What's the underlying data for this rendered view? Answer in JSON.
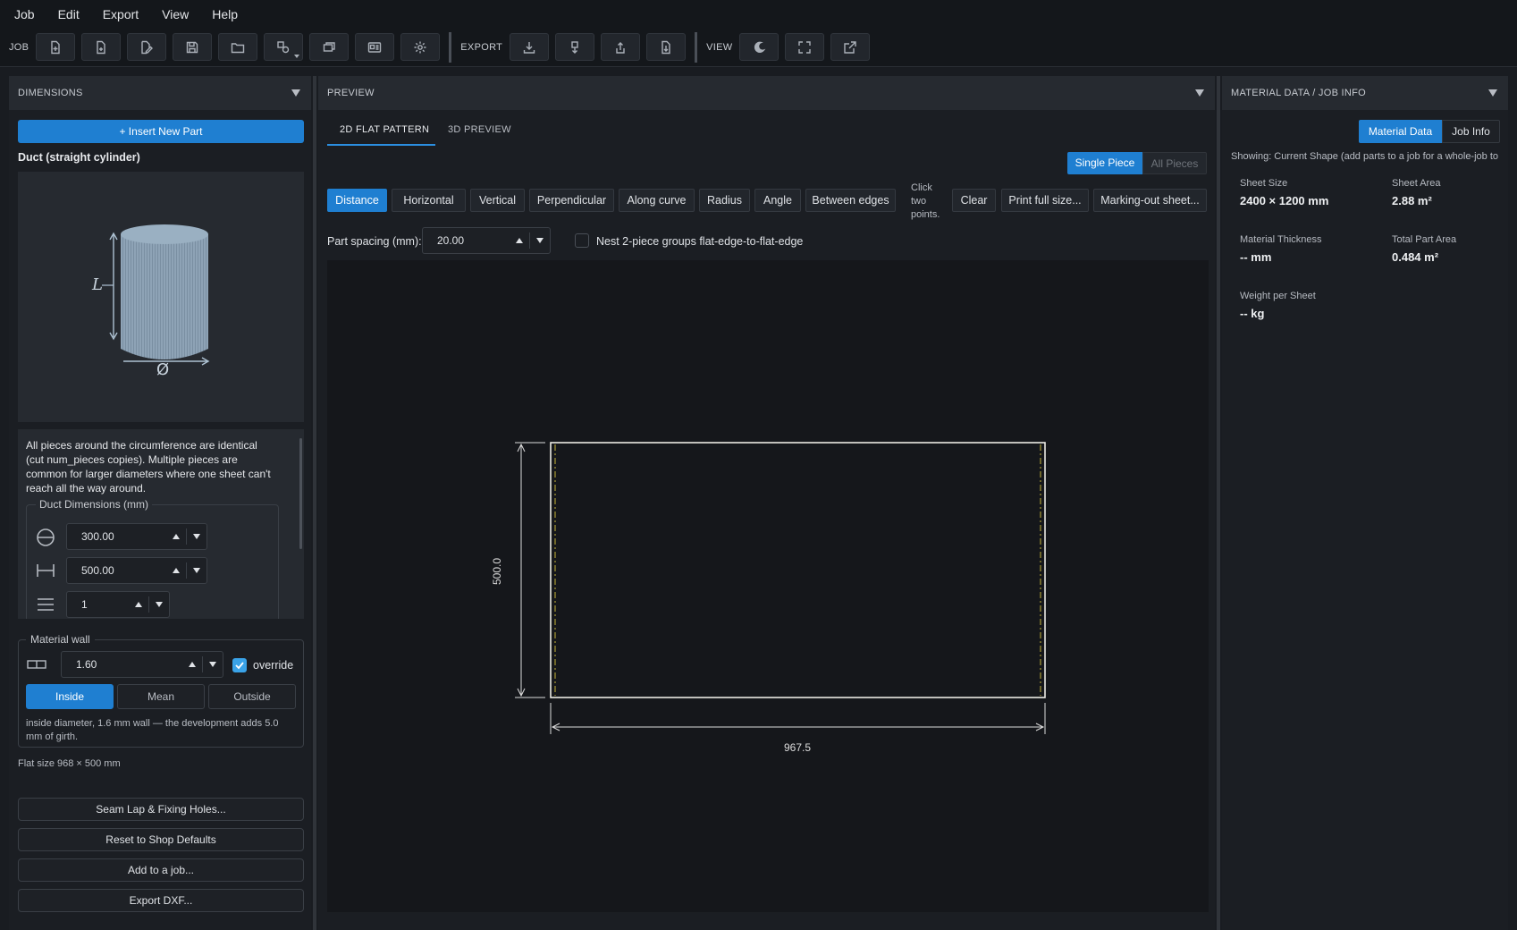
{
  "menu": [
    "Job",
    "Edit",
    "Export",
    "View",
    "Help"
  ],
  "toolbar": {
    "job_label": "JOB",
    "export_label": "EXPORT",
    "view_label": "VIEW"
  },
  "left": {
    "header": "DIMENSIONS",
    "insert_btn": "+ Insert New Part",
    "shape_title": "Duct (straight cylinder)",
    "preview_labels": {
      "length": "L",
      "diameter": "Ø"
    },
    "description": "All pieces around the circumference are identical (cut num_pieces copies). Multiple pieces are common for larger diameters where one sheet can't reach all the way around.",
    "dims_group": "Duct Dimensions (mm)",
    "diameter_value": "300.00",
    "length_value": "500.00",
    "pieces_value": "1",
    "wall_group": "Material wall",
    "wall_value": "1.60",
    "override_label": "override",
    "override_checked": true,
    "modes": [
      "Inside",
      "Mean",
      "Outside"
    ],
    "active_mode": "Inside",
    "wall_note": "inside diameter, 1.6 mm wall — the development adds 5.0 mm of girth.",
    "flat_size": "Flat size 968 × 500 mm",
    "buttons": [
      "Seam Lap & Fixing Holes...",
      "Reset to Shop Defaults",
      "Add to a job...",
      "Export DXF..."
    ]
  },
  "center": {
    "header": "PREVIEW",
    "tabs": [
      "2D FLAT PATTERN",
      "3D PREVIEW"
    ],
    "active_tab": "2D FLAT PATTERN",
    "piece_toggle": [
      "Single Piece",
      "All Pieces"
    ],
    "tools": [
      "Distance",
      "Horizontal",
      "Vertical",
      "Perpendicular",
      "Along curve",
      "Radius",
      "Angle",
      "Between edges"
    ],
    "active_tool": "Distance",
    "hint": [
      "Click",
      "two",
      "points."
    ],
    "actions": [
      "Clear",
      "Print full size...",
      "Marking-out sheet..."
    ],
    "spacing_label": "Part spacing (mm):",
    "spacing_value": "20.00",
    "nest_label": "Nest 2-piece groups flat-edge-to-flat-edge",
    "nest_checked": false,
    "dim_height": "500.0",
    "dim_width": "967.5"
  },
  "right": {
    "header": "MATERIAL DATA / JOB INFO",
    "tabs": [
      "Material Data",
      "Job Info"
    ],
    "active_tab": "Material Data",
    "showing": "Showing: Current Shape (add parts to a job for a whole-job to",
    "sheet_size_label": "Sheet Size",
    "sheet_size_value": "2400 × 1200 mm",
    "sheet_area_label": "Sheet Area",
    "sheet_area_value": "2.88 m²",
    "thickness_label": "Material Thickness",
    "thickness_value": "-- mm",
    "part_area_label": "Total Part Area",
    "part_area_value": "0.484 m²",
    "weight_label": "Weight per Sheet",
    "weight_value": "-- kg"
  },
  "colors": {
    "accent": "#1f7fd1",
    "background": "#191c21",
    "pattern_outline": "#ecebe4",
    "seam_line": "#c8b43a"
  }
}
